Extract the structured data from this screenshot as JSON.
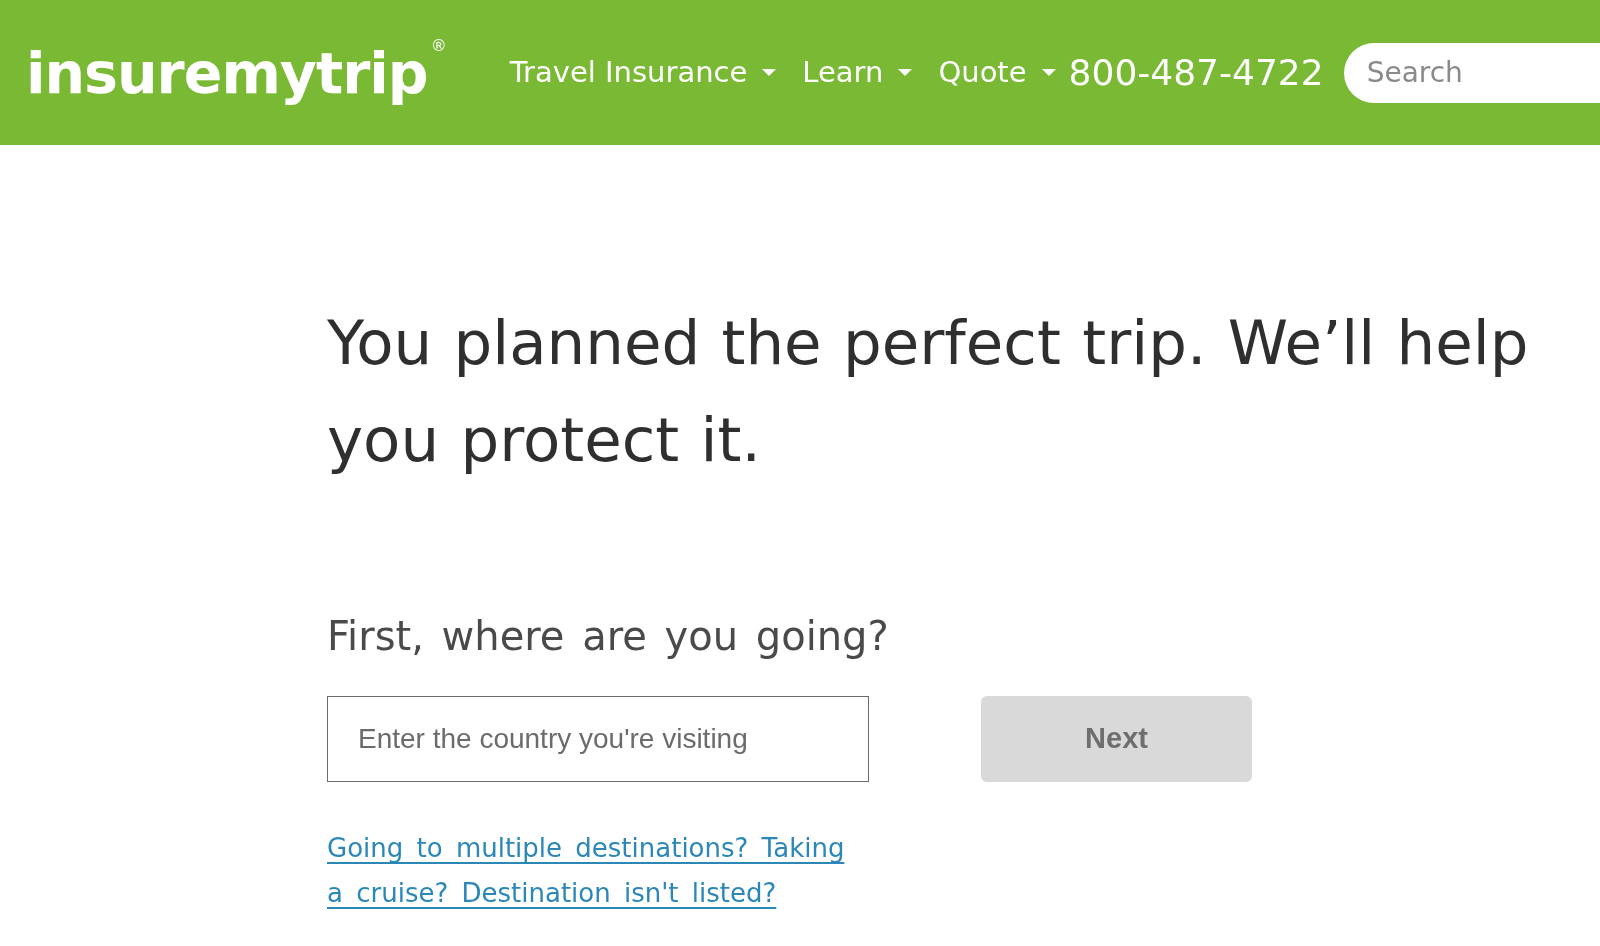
{
  "header": {
    "logo": "insuremytrip$^{®}$",
    "nav": [
      {
        "label": "Travel Insurance",
        "has_dropdown": true
      },
      {
        "label": "Learn",
        "has_dropdown": true
      },
      {
        "label": "Quote",
        "has_dropdown": true
      }
    ],
    "phone": "800-487-4722",
    "search": {
      "placeholder": "Search"
    }
  },
  "hero": {
    "headline": "You planned the perfect trip. We’ll help you protect it.",
    "question": "First, where are you going?",
    "destination_field": {
      "placeholder": "Enter the country you're visiting"
    },
    "next_button": {
      "label": "Next",
      "disabled": true
    },
    "help_link": "Going to multiple destinations? Taking a cruise? Destination isn't listed?"
  }
}
